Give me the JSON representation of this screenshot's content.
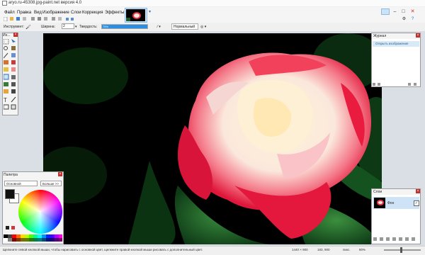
{
  "window": {
    "title": "aryo.ru-45308.jpg-paint.net версия 4.0"
  },
  "menu": {
    "items": [
      "Файл",
      "Правка",
      "Вид",
      "Изображение",
      "Слои",
      "Коррекция",
      "Эффекты"
    ]
  },
  "toolbar": {
    "tool_label": "Инструмент:",
    "width_label": "Ширина:",
    "width_value": "2",
    "hardness_label": "Твердость:",
    "hardness_value": "75%",
    "blend_mode": "Нормальный"
  },
  "panels": {
    "tools_title": "Ин...",
    "palette_title": "Палитра",
    "palette_primary_select": "Основной",
    "palette_more_button": "Больше >>",
    "history_title": "Журнал",
    "history_item": "Открыть изображение",
    "layers_title": "Слои",
    "layer_name": "Фон"
  },
  "status": {
    "hint": "Щелкните левой кнопкой мыши, чтобы нарисовать с основной цвет, щелкните правой кнопкой мыши рисовать с дополнительный цвет.",
    "image_size": "1440 × 900",
    "cursor_pos": "183, 900",
    "units": "пикс.",
    "zoom": "80%"
  },
  "icons": [
    "app-icon",
    "brush-icon",
    "select-icon",
    "move-icon",
    "zoom-icon",
    "pan-icon",
    "magic-wand-icon",
    "bucket-icon",
    "gradient-icon",
    "pencil-icon",
    "eraser-icon",
    "clone-icon",
    "text-icon",
    "line-icon",
    "shape-icon",
    "color-picker-icon",
    "gear-icon",
    "help-icon",
    "minimize-icon",
    "maximize-icon",
    "close-icon"
  ],
  "colors": {
    "accent": "#2a8fe0",
    "primary_color": "#111111",
    "secondary_color": "#ffffff"
  }
}
